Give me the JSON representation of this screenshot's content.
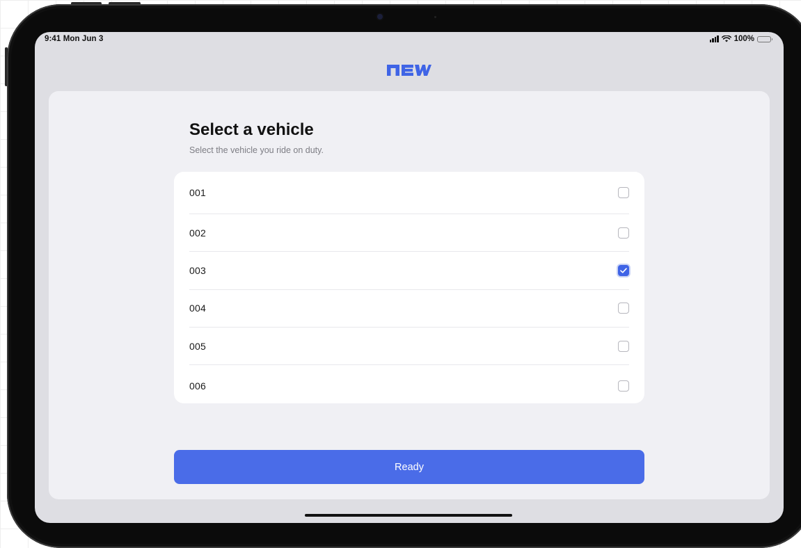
{
  "status_bar": {
    "time": "9:41 Mon Jun 3",
    "battery": "100%"
  },
  "logo": {
    "icon": "new-wordmark-logo",
    "color": "#3f64e6"
  },
  "page": {
    "title": "Select a vehicle",
    "subtitle": "Select the vehicle you ride on duty."
  },
  "vehicles": [
    {
      "label": "001",
      "checked": false
    },
    {
      "label": "002",
      "checked": false
    },
    {
      "label": "003",
      "checked": true
    },
    {
      "label": "004",
      "checked": false
    },
    {
      "label": "005",
      "checked": false
    },
    {
      "label": "006",
      "checked": false
    }
  ],
  "ready_button": {
    "label": "Ready",
    "color": "#4a6ce8"
  }
}
